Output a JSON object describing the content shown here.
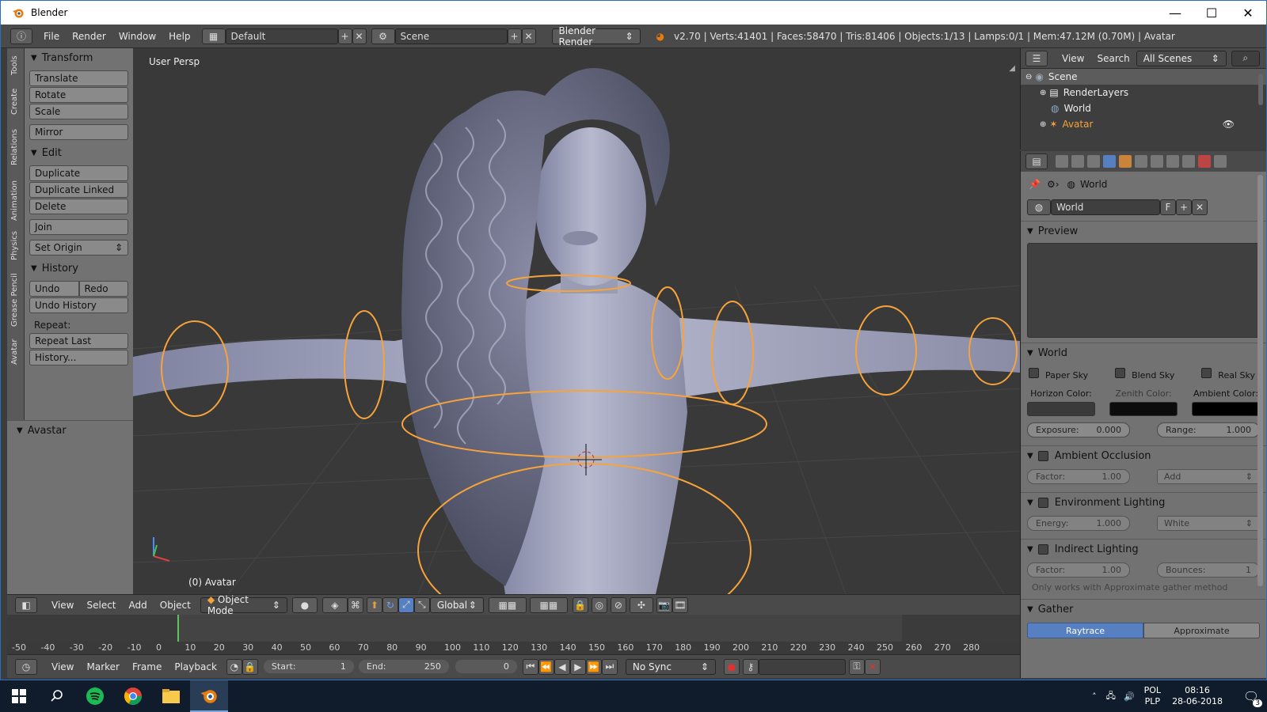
{
  "window": {
    "title": "Blender",
    "minimize_glyph": "—",
    "maximize_glyph": "☐",
    "close_glyph": "✕"
  },
  "infobar": {
    "menus": [
      "File",
      "Render",
      "Window",
      "Help"
    ],
    "layout": "Default",
    "scene": "Scene",
    "engine": "Blender Render",
    "stats": "v2.70 | Verts:41401 | Faces:58470 | Tris:81406 | Objects:1/13 | Lamps:0/1 | Mem:47.12M (0.70M) | Avatar"
  },
  "shelf": {
    "tabs": [
      "Tools",
      "Create",
      "Relations",
      "Animation",
      "Physics",
      "Grease Pencil",
      "Avatar"
    ],
    "transform_title": "Transform",
    "transform_buttons": [
      "Translate",
      "Rotate",
      "Scale"
    ],
    "mirror": "Mirror",
    "edit_title": "Edit",
    "edit_buttons": [
      "Duplicate",
      "Duplicate Linked",
      "Delete"
    ],
    "join": "Join",
    "set_origin": "Set Origin",
    "history_title": "History",
    "undo": "Undo",
    "redo": "Redo",
    "undo_history": "Undo History",
    "repeat_label": "Repeat:",
    "repeat_last": "Repeat Last",
    "history_more": "History...",
    "avastar_title": "Avastar"
  },
  "viewport": {
    "view_label": "User Persp",
    "object_label": "(0) Avatar"
  },
  "viewport_header": {
    "menus": [
      "View",
      "Select",
      "Add",
      "Object"
    ],
    "mode": "Object Mode",
    "orientation": "Global"
  },
  "timeline": {
    "ticks": [
      "-50",
      "-40",
      "-30",
      "-20",
      "-10",
      "0",
      "10",
      "20",
      "30",
      "40",
      "50",
      "60",
      "70",
      "80",
      "90",
      "100",
      "110",
      "120",
      "130",
      "140",
      "150",
      "160",
      "170",
      "180",
      "190",
      "200",
      "210",
      "220",
      "230",
      "240",
      "250",
      "260",
      "270",
      "280"
    ],
    "current_frame_marker": 0,
    "menus": [
      "View",
      "Marker",
      "Frame",
      "Playback"
    ],
    "start_label": "Start:",
    "start": "1",
    "end_label": "End:",
    "end": "250",
    "current": "0",
    "sync": "No Sync"
  },
  "outliner": {
    "menus": [
      "View",
      "Search"
    ],
    "filter": "All Scenes",
    "rows": [
      "Scene",
      "RenderLayers",
      "World",
      "Avatar"
    ]
  },
  "properties": {
    "breadcrumb": "World",
    "datablock": "World",
    "fake_user": "F",
    "preview_title": "Preview",
    "world_title": "World",
    "sky_options": [
      "Paper Sky",
      "Blend Sky",
      "Real Sky"
    ],
    "horizon_label": "Horizon Color:",
    "zenith_label": "Zenith Color:",
    "ambient_label": "Ambient Color:",
    "horizon_color": "#3a3a3a",
    "zenith_color": "#0c0c0c",
    "ambient_color": "#000000",
    "exposure_label": "Exposure:",
    "exposure": "0.000",
    "range_label": "Range:",
    "range": "1.000",
    "ao_title": "Ambient Occlusion",
    "ao_factor_label": "Factor:",
    "ao_factor": "1.00",
    "ao_blend": "Add",
    "env_title": "Environment Lighting",
    "env_energy_label": "Energy:",
    "env_energy": "1.000",
    "env_color": "White",
    "indirect_title": "Indirect Lighting",
    "ind_factor_label": "Factor:",
    "ind_factor": "1.00",
    "ind_bounces_label": "Bounces:",
    "ind_bounces": "1",
    "indirect_note": "Only works with Approximate gather method",
    "gather_title": "Gather",
    "gather_raytrace": "Raytrace",
    "gather_approximate": "Approximate"
  },
  "taskbar": {
    "lang_top": "POL",
    "lang_bottom": "PLP",
    "time": "08:16",
    "date": "28-06-2018",
    "notifications": "3"
  },
  "colors": {
    "accent": "#5680c2",
    "selection": "#f7a33a",
    "title_border": "#2a6fbf"
  }
}
